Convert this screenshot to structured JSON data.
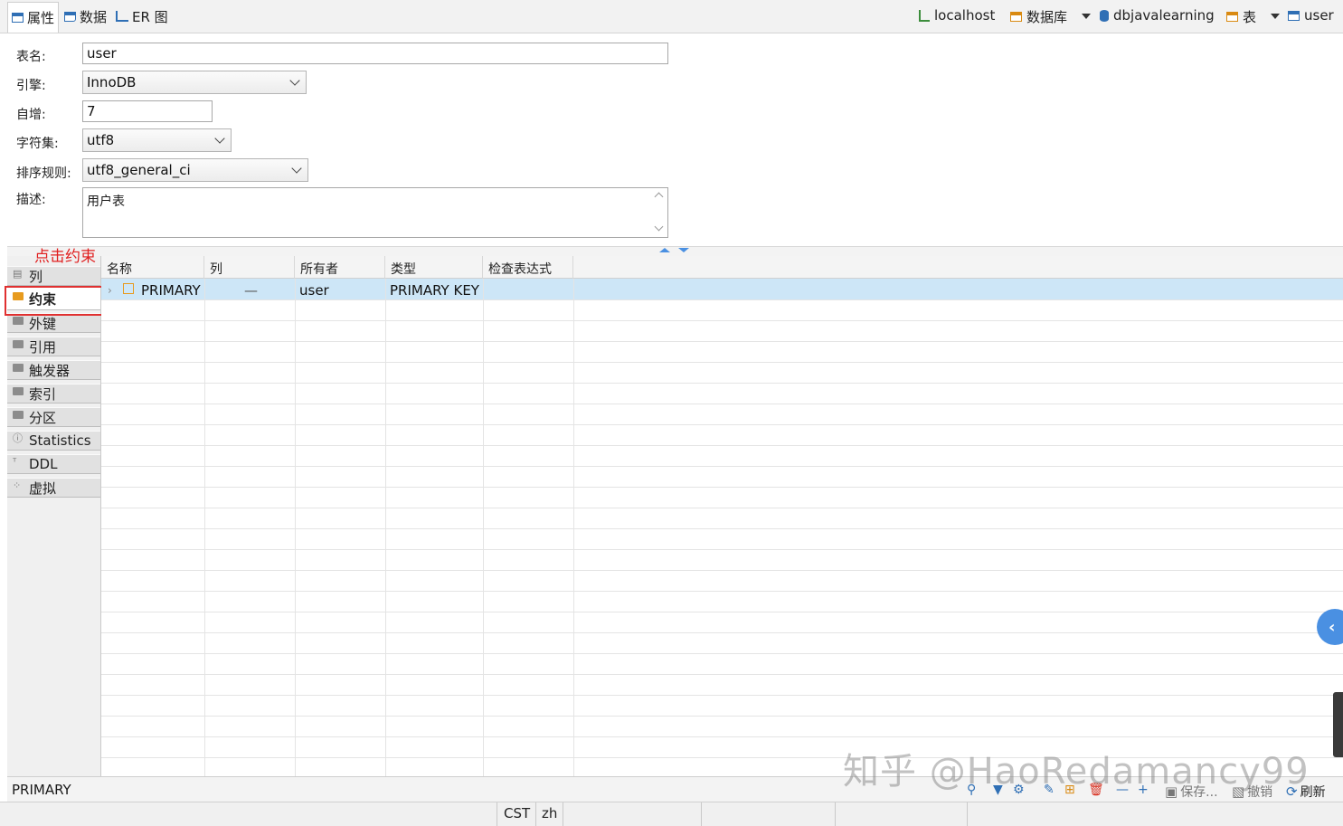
{
  "tabs": [
    {
      "label": "属性",
      "icon": "table-icon",
      "active": true
    },
    {
      "label": "数据",
      "icon": "data-icon",
      "active": false
    },
    {
      "label": "ER 图",
      "icon": "er-diagram-icon",
      "active": false
    }
  ],
  "breadcrumb": {
    "host": "localhost",
    "databases": "数据库",
    "database": "dbjavalearning",
    "tables": "表",
    "table": "user"
  },
  "form": {
    "name_label": "表名:",
    "name_value": "user",
    "engine_label": "引擎:",
    "engine_value": "InnoDB",
    "autoinc_label": "自增:",
    "autoinc_value": "7",
    "charset_label": "字符集:",
    "charset_value": "utf8",
    "collation_label": "排序规则:",
    "collation_value": "utf8_general_ci",
    "desc_label": "描述:",
    "desc_value": "用户表"
  },
  "annotation": "点击约束",
  "nav": [
    {
      "label": "列",
      "icon": "columns-icon"
    },
    {
      "label": "约束",
      "icon": "constraints-folder-icon",
      "active": true
    },
    {
      "label": "外键",
      "icon": "folder-icon"
    },
    {
      "label": "引用",
      "icon": "folder-icon"
    },
    {
      "label": "触发器",
      "icon": "folder-icon"
    },
    {
      "label": "索引",
      "icon": "folder-icon"
    },
    {
      "label": "分区",
      "icon": "folder-icon"
    },
    {
      "label": "Statistics",
      "icon": "info-icon"
    },
    {
      "label": "DDL",
      "icon": "ddl-icon"
    },
    {
      "label": "虚拟",
      "icon": "virtual-icon"
    }
  ],
  "grid": {
    "columns": [
      "名称",
      "列",
      "所有者",
      "类型",
      "检查表达式"
    ],
    "rows": [
      {
        "name": "PRIMARY",
        "column": "—",
        "owner": "user",
        "type": "PRIMARY KEY",
        "check": ""
      }
    ]
  },
  "status": {
    "selected": "PRIMARY",
    "save_label": "保存...",
    "cancel_label": "撤销",
    "refresh_label": "刷新"
  },
  "bottom": {
    "timezone": "CST",
    "locale": "zh"
  },
  "watermark": "知乎 @HaoRedamancy99"
}
